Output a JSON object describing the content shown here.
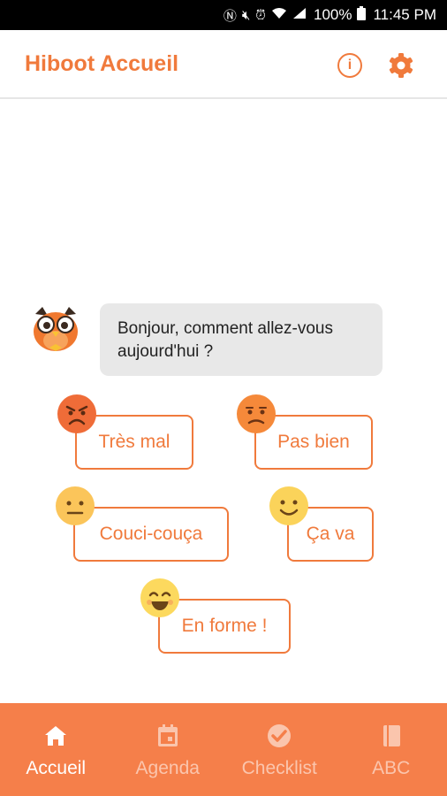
{
  "status_bar": {
    "battery": "100%",
    "time": "11:45 PM",
    "icons": [
      "nfc-icon",
      "mute-icon",
      "alarm-icon",
      "wifi-icon",
      "signal-icon",
      "battery-icon"
    ]
  },
  "app_bar": {
    "title": "Hiboot Accueil",
    "info_label": "i",
    "icons": [
      "info-icon",
      "gear-icon"
    ]
  },
  "chat": {
    "avatar": "owl-avatar",
    "message": "Bonjour, comment allez-vous aujourd'hui ?"
  },
  "moods": [
    {
      "label": "Très mal",
      "icon": "angry-face-icon"
    },
    {
      "label": "Pas bien",
      "icon": "sad-face-icon"
    },
    {
      "label": "Couci-couça",
      "icon": "neutral-face-icon"
    },
    {
      "label": "Ça va",
      "icon": "smile-face-icon"
    },
    {
      "label": "En forme !",
      "icon": "grin-face-icon"
    }
  ],
  "nav": [
    {
      "label": "Accueil",
      "icon": "home-icon",
      "active": true
    },
    {
      "label": "Agenda",
      "icon": "calendar-icon",
      "active": false
    },
    {
      "label": "Checklist",
      "icon": "check-circle-icon",
      "active": false
    },
    {
      "label": "ABC",
      "icon": "book-icon",
      "active": false
    }
  ],
  "colors": {
    "accent": "#f07a3c",
    "nav_background": "#f57f4a",
    "bubble": "#e8e8e8",
    "face_red": "#ef6c38",
    "face_orange": "#f5893a",
    "face_yellow": "#fbd35a"
  }
}
